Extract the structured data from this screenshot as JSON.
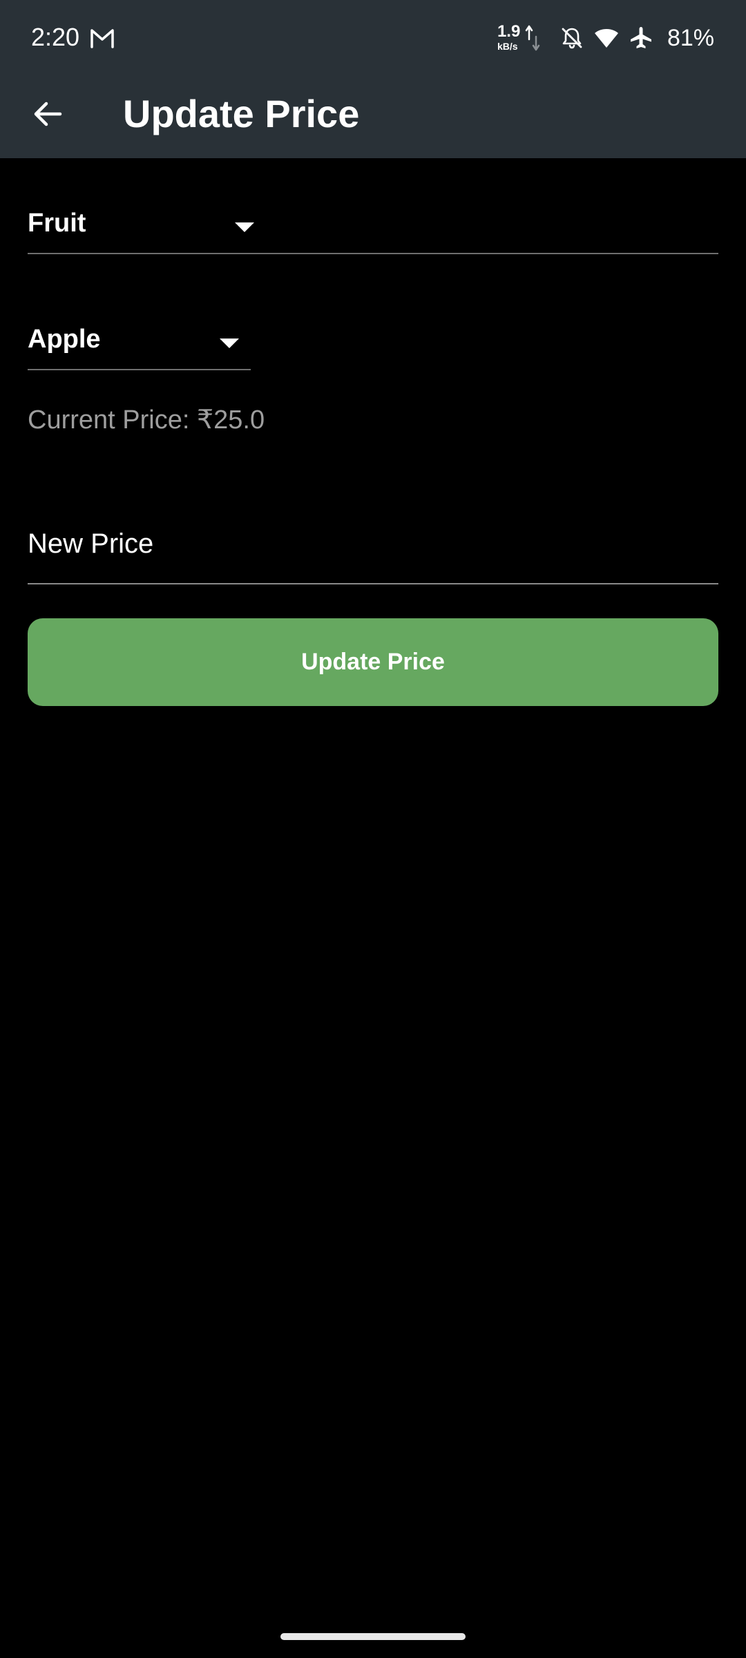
{
  "status_bar": {
    "time": "2:20",
    "net_speed_value": "1.9",
    "net_speed_unit": "kB/s",
    "battery": "81%",
    "icons": [
      "gmail-icon",
      "data-arrows-icon",
      "notifications-off-icon",
      "wifi-icon",
      "airplane-mode-icon"
    ]
  },
  "app_bar": {
    "title": "Update Price",
    "back_icon": "arrow-back-icon"
  },
  "form": {
    "category_dropdown": {
      "selected": "Fruit"
    },
    "item_dropdown": {
      "selected": "Apple"
    },
    "current_price_text": "Current Price: ₹25.0",
    "new_price": {
      "placeholder": "New Price",
      "value": ""
    },
    "submit_label": "Update Price"
  },
  "colors": {
    "app_bar_bg": "#293137",
    "background": "#000000",
    "button_bg": "#66a860",
    "muted_text": "#9e9e9e"
  }
}
